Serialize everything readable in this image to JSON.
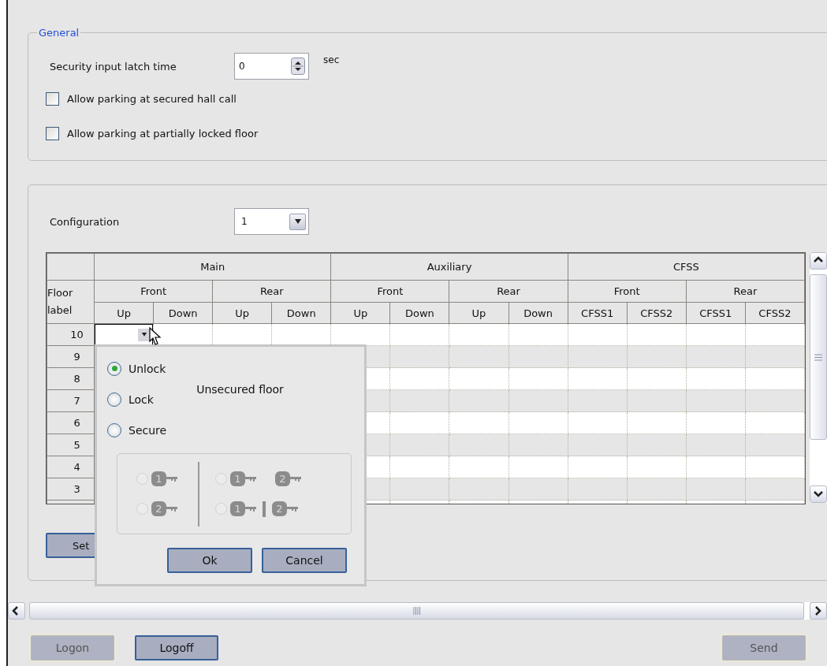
{
  "general": {
    "legend": "General",
    "latch": {
      "label": "Security input latch time",
      "value": "0",
      "unit": "sec"
    },
    "checkboxes": [
      {
        "label": "Allow parking at secured hall call",
        "checked": false
      },
      {
        "label": "Allow parking at partially locked floor",
        "checked": false
      }
    ]
  },
  "configuration": {
    "label": "Configuration",
    "value": "1"
  },
  "table": {
    "floor_header": "Floor label",
    "groups": [
      {
        "label": "Main",
        "sides": [
          {
            "label": "Front",
            "columns": [
              "Up",
              "Down"
            ]
          },
          {
            "label": "Rear",
            "columns": [
              "Up",
              "Down"
            ]
          }
        ]
      },
      {
        "label": "Auxiliary",
        "sides": [
          {
            "label": "Front",
            "columns": [
              "Up",
              "Down"
            ]
          },
          {
            "label": "Rear",
            "columns": [
              "Up",
              "Down"
            ]
          }
        ]
      },
      {
        "label": "CFSS",
        "sides": [
          {
            "label": "Front",
            "columns": [
              "CFSS1",
              "CFSS2"
            ]
          },
          {
            "label": "Rear",
            "columns": [
              "CFSS1",
              "CFSS2"
            ]
          }
        ]
      }
    ],
    "rows": [
      {
        "label": "10",
        "editing": true
      },
      {
        "label": "9"
      },
      {
        "label": "8"
      },
      {
        "label": "7"
      },
      {
        "label": "6"
      },
      {
        "label": "5"
      },
      {
        "label": "4"
      },
      {
        "label": "3"
      }
    ]
  },
  "set_button": "Set",
  "popup": {
    "options": [
      {
        "label": "Unlock",
        "selected": true
      },
      {
        "label": "Lock",
        "selected": false
      },
      {
        "label": "Secure",
        "selected": false
      }
    ],
    "status": "Unsecured floor",
    "key_group": {
      "disabled": true,
      "left": [
        {
          "keys": [
            "1"
          ],
          "selected": false
        },
        {
          "keys": [
            "2"
          ],
          "selected": false
        }
      ],
      "right": [
        {
          "keys": [
            "1",
            "2"
          ],
          "kind": "and",
          "selected": false
        },
        {
          "keys": [
            "1",
            "2"
          ],
          "kind": "or",
          "selected": false
        }
      ]
    },
    "buttons": [
      "Ok",
      "Cancel"
    ]
  },
  "footer": {
    "left": [
      {
        "label": "Logon",
        "disabled": true
      },
      {
        "label": "Logoff",
        "disabled": false
      }
    ],
    "right": [
      {
        "label": "Send",
        "disabled": true
      }
    ]
  }
}
